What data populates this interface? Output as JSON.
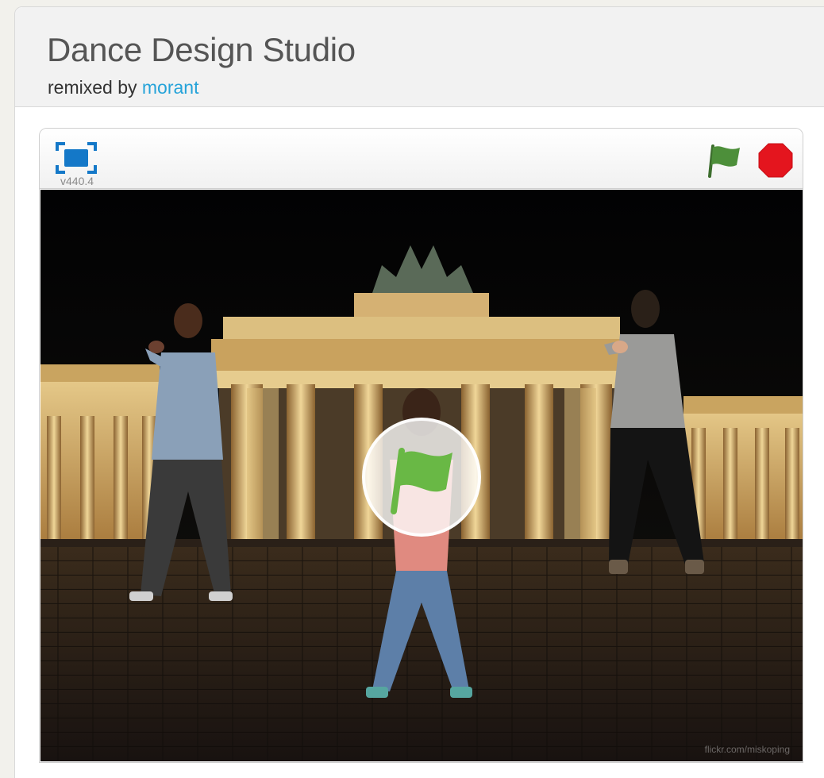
{
  "project": {
    "title": "Dance Design Studio",
    "remix_prefix": "remixed by ",
    "author": "morant"
  },
  "player": {
    "version": "v440.4",
    "credit": "flickr.com/miskoping"
  },
  "icons": {
    "fullscreen": "fullscreen-icon",
    "green_flag": "green-flag-icon",
    "stop": "stop-sign-icon",
    "start_overlay": "green-flag-icon"
  },
  "colors": {
    "link": "#25a3d9",
    "flag_green": "#4d8f3a",
    "stop_red": "#e4151e",
    "fullscreen_blue": "#1478c8"
  }
}
